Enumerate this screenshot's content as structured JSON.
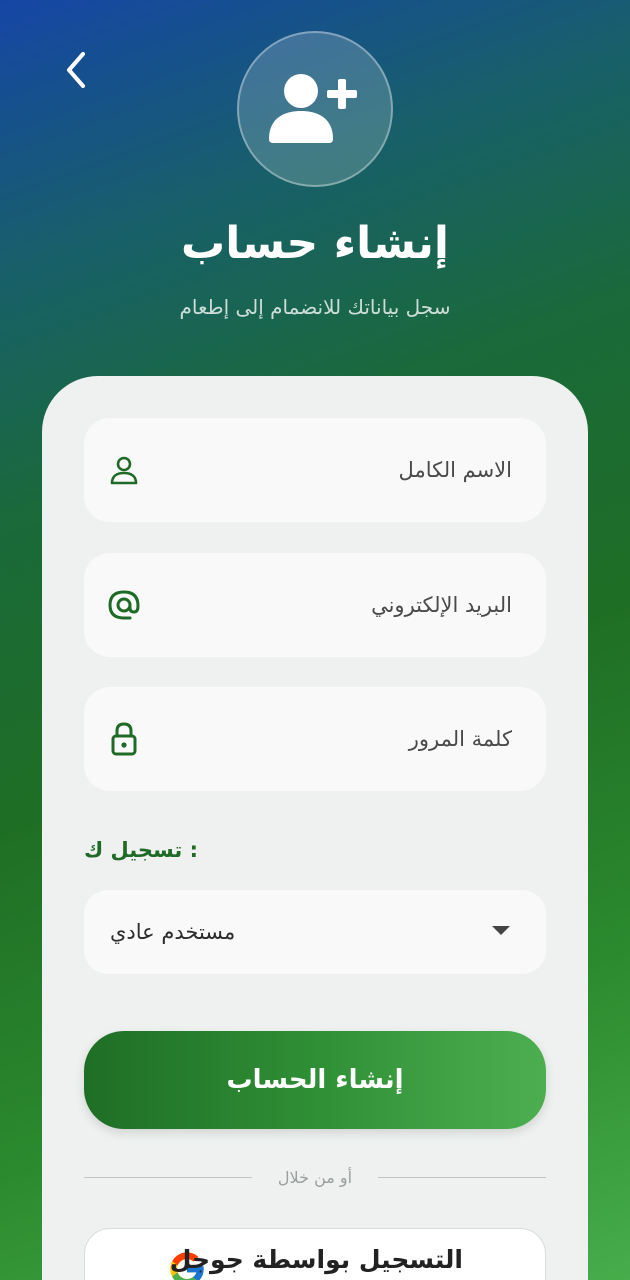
{
  "header": {
    "title": "إنشاء حساب",
    "subtitle": "سجل بياناتك للانضمام إلى إطعام",
    "back_icon": "chevron-left-icon",
    "avatar_icon": "person-add-icon"
  },
  "form": {
    "full_name": {
      "placeholder": "الاسم الكامل",
      "icon": "person-icon"
    },
    "email": {
      "placeholder": "البريد الإلكتروني",
      "icon": "at-icon"
    },
    "password": {
      "placeholder": "كلمة المرور",
      "icon": "lock-icon"
    },
    "register_as_label": ": تسجيل ك",
    "role_select": {
      "selected": "مستخدم عادي",
      "icon": "caret-down-icon"
    },
    "submit_label": "إنشاء الحساب",
    "divider_text": "أو من خلال",
    "google_label": "التسجيل بواسطة جوجل"
  },
  "colors": {
    "accent": "#1f6a26",
    "button_start": "#1f6e26",
    "button_end": "#4cae51",
    "card_bg": "#eef1ef"
  }
}
